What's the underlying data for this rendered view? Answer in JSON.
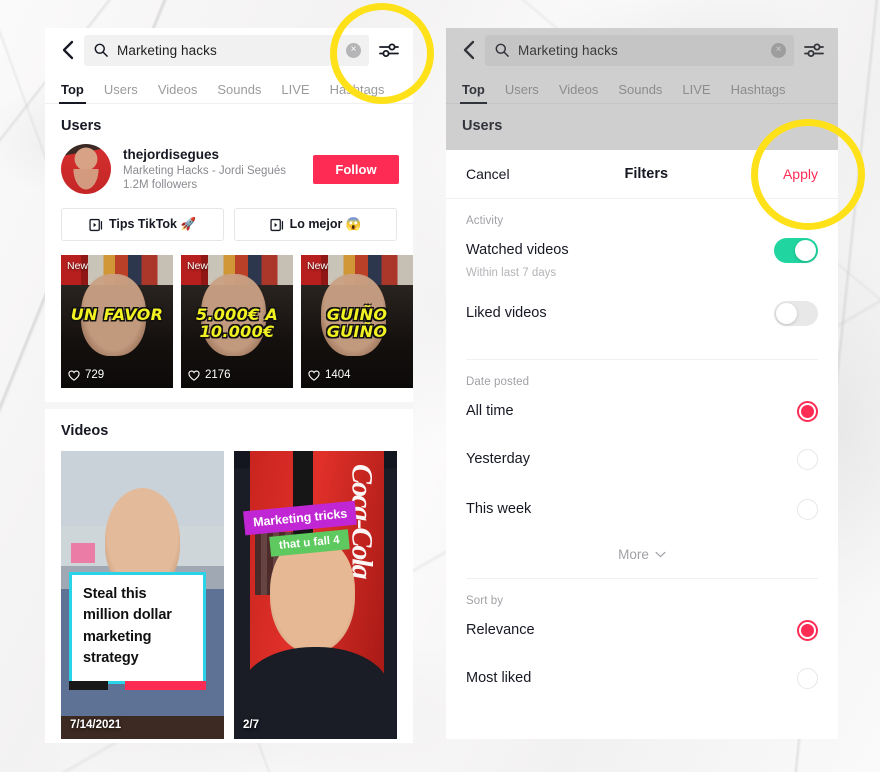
{
  "search": {
    "query": "Marketing hacks",
    "search_icon": "magnifier-icon",
    "clear_icon": "×",
    "back_icon": "chevron-left-icon",
    "filter_icon": "sliders-icon"
  },
  "tabs": [
    {
      "label": "Top",
      "active": true
    },
    {
      "label": "Users",
      "active": false
    },
    {
      "label": "Videos",
      "active": false
    },
    {
      "label": "Sounds",
      "active": false
    },
    {
      "label": "LIVE",
      "active": false
    },
    {
      "label": "Hashtags",
      "active": false
    }
  ],
  "sections": {
    "users_heading": "Users",
    "videos_heading": "Videos"
  },
  "user": {
    "handle": "thejordisegues",
    "display_name": "Marketing Hacks - Jordi Segués",
    "followers": "1.2M followers",
    "follow_label": "Follow"
  },
  "playlists": [
    {
      "icon": "playlist-icon",
      "label": "Tips TikTok 🚀"
    },
    {
      "icon": "playlist-icon",
      "label": "Lo mejor 😱"
    }
  ],
  "thumbnails": [
    {
      "badge": "New",
      "caption": "UN FAVOR",
      "likes": "729",
      "heart_icon": "heart-outline-icon"
    },
    {
      "badge": "New",
      "caption": "5.000€ A\n10.000€",
      "likes": "2176",
      "heart_icon": "heart-outline-icon"
    },
    {
      "badge": "New",
      "caption": "GUIÑO\nGUIÑO",
      "likes": "1404",
      "heart_icon": "heart-outline-icon"
    }
  ],
  "videos": [
    {
      "overlay_text": "Steal this million dollar marketing strategy",
      "date": "7/14/2021"
    },
    {
      "sticker_purple": "Marketing tricks",
      "sticker_green": "that u fall 4",
      "date": "2/7"
    }
  ],
  "filters_sheet": {
    "cancel_label": "Cancel",
    "title": "Filters",
    "apply_label": "Apply",
    "activity": {
      "group_label": "Activity",
      "watched": {
        "label": "Watched videos",
        "sub": "Within last 7 days",
        "on": true
      },
      "liked": {
        "label": "Liked videos",
        "on": false
      }
    },
    "date_posted": {
      "group_label": "Date posted",
      "options": [
        {
          "label": "All time",
          "selected": true
        },
        {
          "label": "Yesterday",
          "selected": false
        },
        {
          "label": "This week",
          "selected": false
        }
      ],
      "more_label": "More",
      "more_icon": "chevron-down-icon"
    },
    "sort_by": {
      "group_label": "Sort by",
      "options": [
        {
          "label": "Relevance",
          "selected": true
        },
        {
          "label": "Most liked",
          "selected": false
        }
      ]
    }
  },
  "annotations": {
    "color": "#ffe11a",
    "circles": [
      "filter-icon-highlight",
      "apply-button-highlight"
    ]
  },
  "theme": {
    "brand_red": "#fe2c55",
    "toggle_green": "#20d5a0",
    "text_dark": "#161823",
    "text_muted": "#8a8b91"
  }
}
